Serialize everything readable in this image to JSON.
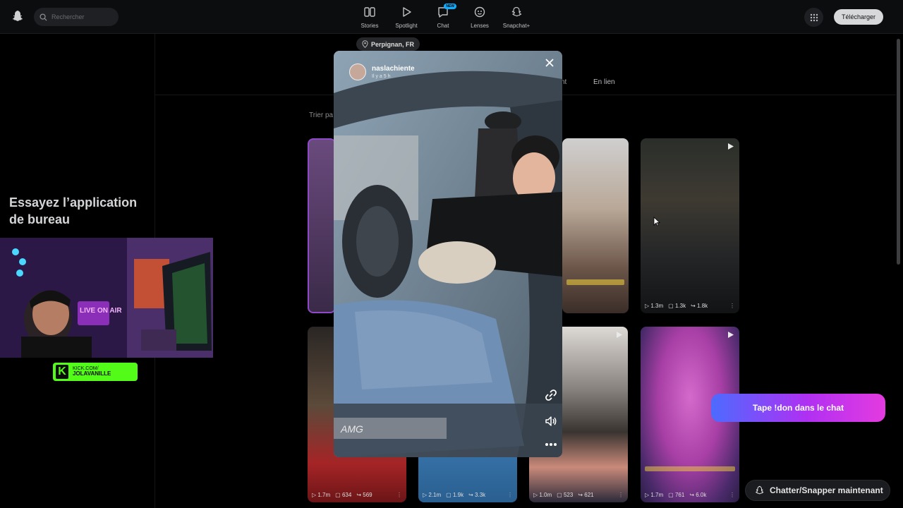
{
  "topbar": {
    "search_placeholder": "Rechercher",
    "nav": [
      {
        "label": "Stories",
        "icon": "stories-icon"
      },
      {
        "label": "Spotlight",
        "icon": "spotlight-icon"
      },
      {
        "label": "Chat",
        "icon": "chat-icon",
        "badge": "NEW"
      },
      {
        "label": "Lenses",
        "icon": "lenses-icon"
      },
      {
        "label": "Snapchat+",
        "icon": "snapchat-plus-icon"
      }
    ],
    "download_label": "Télécharger"
  },
  "sidebar": {
    "promo_text": "Essayez l’application de bureau"
  },
  "profile": {
    "location": "Perpignan, FR",
    "tab_partial": "nt",
    "tab_link": "En lien",
    "sort_label": "Trier pa"
  },
  "cards": [
    {
      "views": "1.3m",
      "comments": "1.3k",
      "shares": "1.8k"
    },
    {
      "views": "1.7m",
      "comments": "634",
      "shares": "569"
    },
    {
      "views": "2.1m",
      "comments": "1.9k",
      "shares": "3.3k"
    },
    {
      "views": "1.0m",
      "comments": "523",
      "shares": "621"
    },
    {
      "views": "1.7m",
      "comments": "761",
      "shares": "6.0k"
    }
  ],
  "story_modal": {
    "username": "naslachiente",
    "time_ago": "Il y a 5 h",
    "plate_text": "AMG"
  },
  "stream_overlay": {
    "kick_url": "KICK.COM/",
    "kick_channel": "JOLAVANILLE",
    "neon_sign": "LIVE ON AIR",
    "donate_cta": "Tape !don dans le chat"
  },
  "chat_cta": "Chatter/Snapper maintenant",
  "colors": {
    "accent_blue": "#0fadff",
    "kick_green": "#53fc18",
    "donate_gradient_start": "#4c6bff",
    "donate_gradient_end": "#e43be0"
  }
}
